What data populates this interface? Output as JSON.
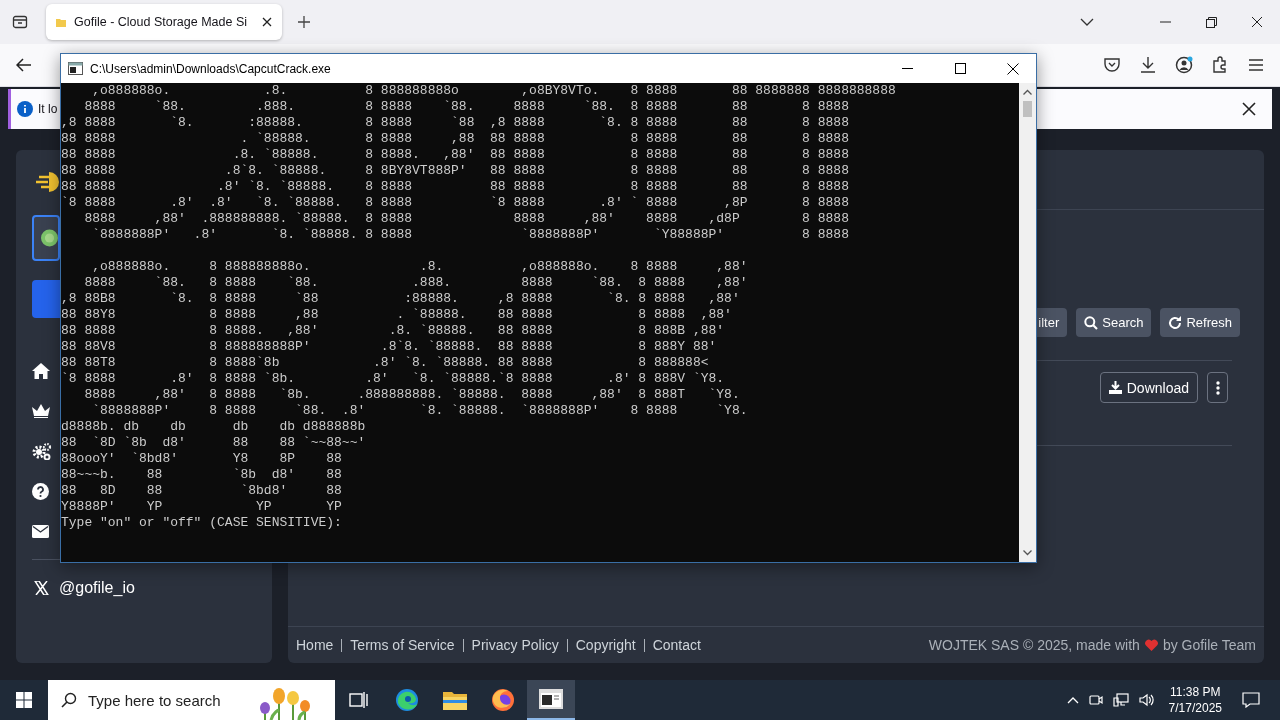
{
  "browser": {
    "tab_title": "Gofile - Cloud Storage Made Si",
    "notification": "It lo"
  },
  "sidebar": {
    "social": "@gofile_io"
  },
  "toolbar": {
    "buttons": [
      {
        "kind": "filter",
        "label": "ilter"
      },
      {
        "kind": "search",
        "label": "Search"
      },
      {
        "kind": "refresh",
        "label": "Refresh"
      }
    ]
  },
  "file_actions": {
    "download": "Download"
  },
  "footer": {
    "links": [
      "Home",
      "Terms of Service",
      "Privacy Policy",
      "Copyright",
      "Contact"
    ],
    "credit_before": "WOJTEK SAS © 2025, made with",
    "credit_after": "by Gofile Team"
  },
  "console": {
    "title": "C:\\Users\\admin\\Downloads\\CapcutCrack.exe",
    "sections": [
      {
        "lines": [
          "    ,o888888o.            .8.          8 888888888o        ,o8BY8VTo.    8 8888       88 8888888 8888888888",
          "   8888     `88.         .888.         8 8888    `88.     8888     `88.  8 8888       88       8 8888",
          ",8 8888       `8.       :88888.        8 8888     `88  ,8 8888       `8. 8 8888       88       8 8888",
          "88 8888                . `88888.       8 8888     ,88  88 8888           8 8888       88       8 8888",
          "88 8888               .8. `88888.      8 8888.   ,88'  88 8888           8 8888       88       8 8888",
          "88 8888              .8`8. `88888.     8 8BY8VT888P'   88 8888           8 8888       88       8 8888",
          "88 8888             .8' `8. `88888.    8 8888          88 8888           8 8888       88       8 8888",
          "`8 8888       .8'  .8'   `8. `88888.   8 8888          `8 8888       .8' ` 8888      ,8P       8 8888",
          "   8888     ,88'  .888888888. `88888.  8 8888             8888     ,88'    8888    ,d8P        8 8888",
          "    `8888888P'   .8'       `8. `88888. 8 8888              `8888888P'       `Y88888P'          8 8888"
        ]
      },
      {
        "lines": [
          "    ,o888888o.     8 888888888o.              .8.          ,o888888o.    8 8888     ,88'",
          "   8888     `88.   8 8888    `88.            .888.         8888     `88.  8 8888    ,88'",
          ",8 88B8       `8.  8 8888     `88           :88888.     ,8 8888       `8. 8 8888   ,88'",
          "88 88Y8            8 8888     ,88          . `88888.    88 8888           8 8888  ,88'",
          "88 8888            8 8888.   ,88'         .8. `88888.   88 8888           8 888B ,88'",
          "88 88V8            8 888888888P'         .8`8. `88888.  88 8888           8 888Y 88'",
          "88 88T8            8 8888`8b            .8' `8. `88888. 88 8888           8 888888<",
          "`8 8888       .8'  8 8888 `8b.         .8'   `8. `88888.`8 8888       .8' 8 888V `Y8.",
          "   8888     ,88'   8 8888   `8b.      .888888888. `88888.  8888     ,88'  8 888T   `Y8.",
          "    `8888888P'     8 8888     `88.  .8'       `8. `88888.  `8888888P'    8 8888     `Y8.",
          "d8888b. db    db      db    db d888888b",
          "88  `8D `8b  d8'      88    88 `~~88~~'",
          "88oooY'  `8bd8'       Y8    8P    88",
          "88~~~b.    88         `8b  d8'    88",
          "88   8D    88          `8bd8'     88",
          "Y8888P'    YP            YP       YP",
          "Type \"on\" or \"off\" (CASE SENSITIVE):"
        ]
      }
    ]
  },
  "taskbar": {
    "search_placeholder": "Type here to search",
    "time": "11:38 PM",
    "date": "7/17/2025",
    "apps": [
      {
        "kind": "taskview",
        "selected": false
      },
      {
        "kind": "edge",
        "selected": false
      },
      {
        "kind": "explorer",
        "selected": false
      },
      {
        "kind": "firefox",
        "selected": false
      },
      {
        "kind": "console",
        "selected": true
      }
    ]
  }
}
